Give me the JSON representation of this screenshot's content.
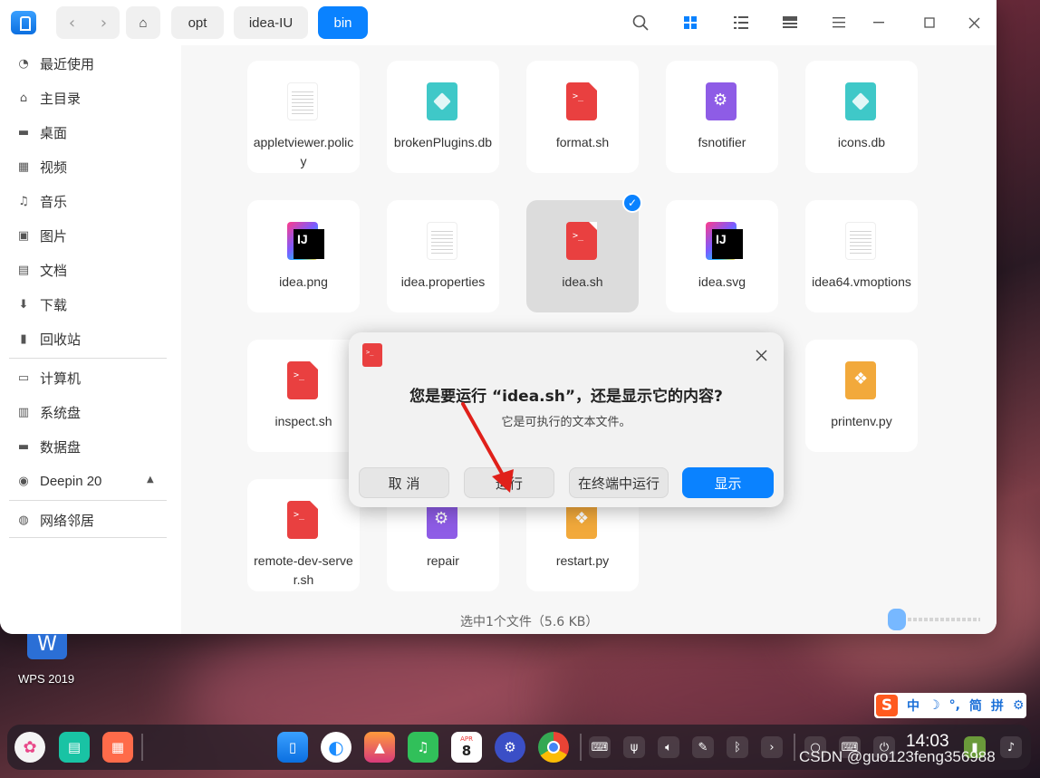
{
  "window": {
    "breadcrumbs": [
      "opt",
      "idea-IU",
      "bin"
    ],
    "nav": {
      "back": "‹",
      "forward": "›"
    }
  },
  "sidebar": {
    "items": [
      {
        "label": "最近使用",
        "icon": "clock-icon"
      },
      {
        "label": "主目录",
        "icon": "home-icon"
      },
      {
        "label": "桌面",
        "icon": "desktop-icon"
      },
      {
        "label": "视频",
        "icon": "video-icon"
      },
      {
        "label": "音乐",
        "icon": "music-icon"
      },
      {
        "label": "图片",
        "icon": "picture-icon"
      },
      {
        "label": "文档",
        "icon": "document-icon"
      },
      {
        "label": "下载",
        "icon": "download-icon"
      },
      {
        "label": "回收站",
        "icon": "trash-icon"
      },
      {
        "label": "计算机",
        "icon": "computer-icon"
      },
      {
        "label": "系统盘",
        "icon": "disk-icon"
      },
      {
        "label": "数据盘",
        "icon": "disk-icon"
      },
      {
        "label": "Deepin 20",
        "icon": "disc-icon"
      },
      {
        "label": "网络邻居",
        "icon": "network-icon"
      }
    ]
  },
  "files": [
    {
      "name": "appletviewer.policy",
      "type": "txt"
    },
    {
      "name": "brokenPlugins.db",
      "type": "db"
    },
    {
      "name": "format.sh",
      "type": "sh"
    },
    {
      "name": "fsnotifier",
      "type": "exe"
    },
    {
      "name": "icons.db",
      "type": "db"
    },
    {
      "name": "idea.png",
      "type": "ij"
    },
    {
      "name": "idea.properties",
      "type": "txt"
    },
    {
      "name": "idea.sh",
      "type": "sh",
      "selected": true
    },
    {
      "name": "idea.svg",
      "type": "ij"
    },
    {
      "name": "idea64.vmoptions",
      "type": "txt"
    },
    {
      "name": "inspect.sh",
      "type": "sh"
    },
    {
      "name": "printenv.py",
      "type": "py"
    },
    {
      "name": "remote-dev-server.sh",
      "type": "sh"
    },
    {
      "name": "repair",
      "type": "exe"
    },
    {
      "name": "restart.py",
      "type": "py"
    }
  ],
  "status": {
    "text": "选中1个文件（5.6 KB）"
  },
  "dialog": {
    "title": "您是要运行 “idea.sh”，还是显示它的内容?",
    "message": "它是可执行的文本文件。",
    "buttons": {
      "cancel": "取 消",
      "run": "运行",
      "run_in_terminal": "在终端中运行",
      "show": "显示"
    }
  },
  "desktop": {
    "wps_label": "WPS 2019"
  },
  "ime": {
    "items": [
      "中",
      "☽",
      "°,",
      "简",
      "拼",
      "⚙"
    ]
  },
  "taskbar": {
    "time": "14:03",
    "calendar_day": "8",
    "calendar_month": "APR"
  },
  "watermark": "CSDN @guo123feng356988",
  "colors": {
    "accent": "#0a82ff",
    "sh_icon": "#e94040",
    "db_icon": "#3fc8c8",
    "exe_icon": "#8e5ce6",
    "py_icon": "#f2a93b"
  }
}
